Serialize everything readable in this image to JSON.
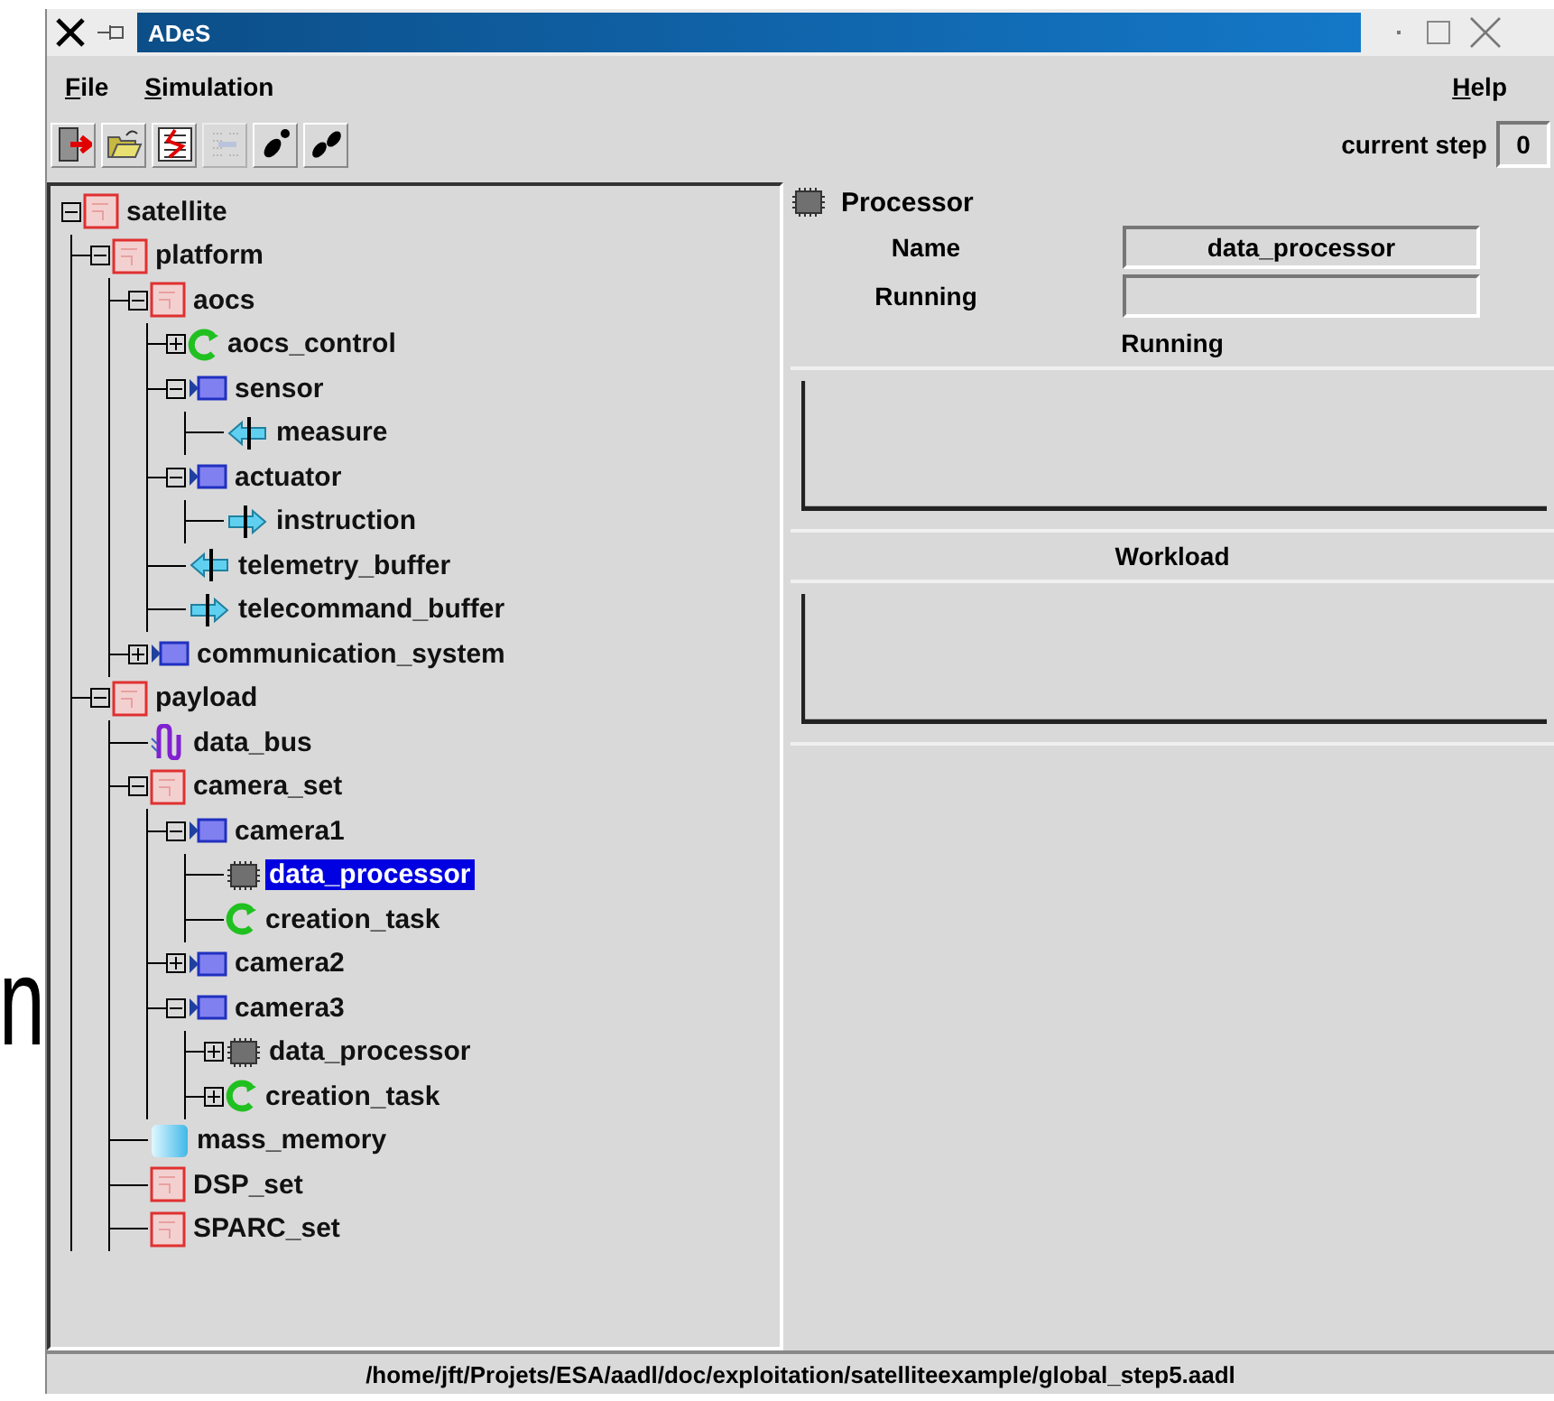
{
  "background_text": "n",
  "window": {
    "title": "ADeS"
  },
  "menu": {
    "left": [
      {
        "label": "File"
      },
      {
        "label": "Simulation"
      }
    ],
    "right": [
      {
        "label": "Help"
      }
    ]
  },
  "toolbar": [
    {
      "kind": "exit",
      "disabled": false
    },
    {
      "kind": "open",
      "disabled": false
    },
    {
      "kind": "tree",
      "disabled": false
    },
    {
      "kind": "grid",
      "disabled": true
    },
    {
      "kind": "step",
      "disabled": false
    },
    {
      "kind": "run",
      "disabled": false
    }
  ],
  "current_step": {
    "label": "current step",
    "value": "0"
  },
  "tree": [
    {
      "label": "satellite",
      "kind": "system",
      "expanded": true,
      "selected": false,
      "children": [
        {
          "label": "platform",
          "kind": "system",
          "expanded": true,
          "selected": false,
          "children": [
            {
              "label": "aocs",
              "kind": "system",
              "expanded": true,
              "selected": false,
              "children": [
                {
                  "label": "aocs_control",
                  "kind": "thread",
                  "expanded": false,
                  "selected": false
                },
                {
                  "label": "sensor",
                  "kind": "device",
                  "expanded": true,
                  "selected": false,
                  "children": [
                    {
                      "label": "measure",
                      "kind": "in_port",
                      "selected": false
                    }
                  ]
                },
                {
                  "label": "actuator",
                  "kind": "device",
                  "expanded": true,
                  "selected": false,
                  "children": [
                    {
                      "label": "instruction",
                      "kind": "out_port",
                      "selected": false
                    }
                  ]
                },
                {
                  "label": "telemetry_buffer",
                  "kind": "in_port",
                  "selected": false
                },
                {
                  "label": "telecommand_buffer",
                  "kind": "out_port",
                  "selected": false
                }
              ]
            },
            {
              "label": "communication_system",
              "kind": "device",
              "expanded": false,
              "selected": false
            }
          ]
        },
        {
          "label": "payload",
          "kind": "system",
          "expanded": true,
          "selected": false,
          "children": [
            {
              "label": "data_bus",
              "kind": "bus",
              "selected": false
            },
            {
              "label": "camera_set",
              "kind": "system",
              "expanded": true,
              "selected": false,
              "children": [
                {
                  "label": "camera1",
                  "kind": "device",
                  "expanded": true,
                  "selected": false,
                  "children": [
                    {
                      "label": "data_processor",
                      "kind": "processor",
                      "selected": true
                    },
                    {
                      "label": "creation_task",
                      "kind": "thread",
                      "selected": false
                    }
                  ]
                },
                {
                  "label": "camera2",
                  "kind": "device",
                  "expanded": false,
                  "selected": false
                },
                {
                  "label": "camera3",
                  "kind": "device",
                  "expanded": true,
                  "selected": false,
                  "children": [
                    {
                      "label": "data_processor",
                      "kind": "processor",
                      "expanded": false,
                      "selected": false
                    },
                    {
                      "label": "creation_task",
                      "kind": "thread",
                      "expanded": false,
                      "selected": false
                    }
                  ]
                }
              ]
            },
            {
              "label": "mass_memory",
              "kind": "memory",
              "selected": false
            },
            {
              "label": "DSP_set",
              "kind": "system",
              "selected": false
            },
            {
              "label": "SPARC_set",
              "kind": "system",
              "selected": false
            }
          ]
        }
      ]
    }
  ],
  "details": {
    "kind": "processor",
    "title": "Processor",
    "fields": [
      {
        "label": "Name",
        "value": "data_processor"
      },
      {
        "label": "Running"
      }
    ],
    "plots": [
      {
        "title": "Running"
      },
      {
        "title": "Workload"
      }
    ]
  },
  "status_bar": "/home/jft/Projets/ESA/aadl/doc/exploitation/satelliteexample/global_step5.aadl"
}
